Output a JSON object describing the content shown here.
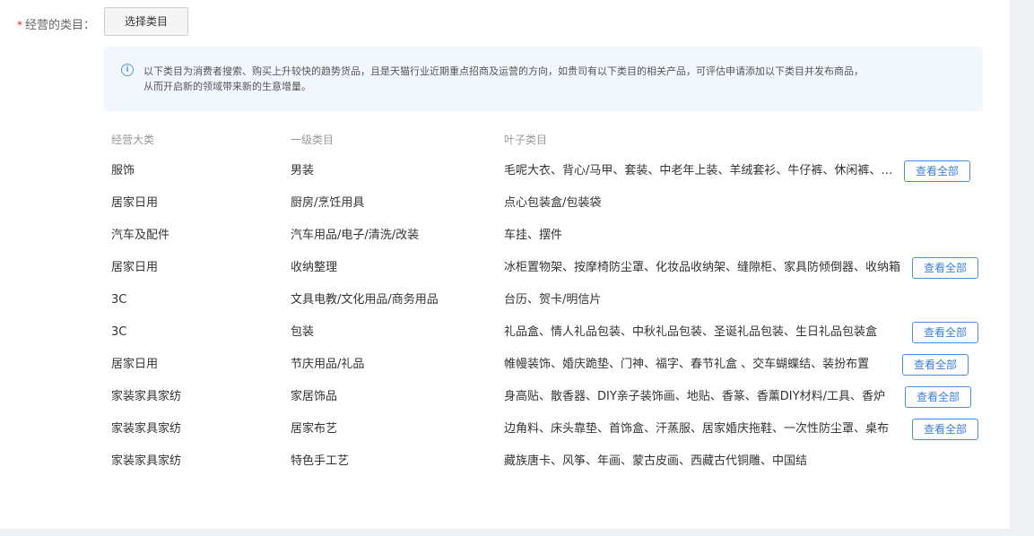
{
  "form": {
    "required_mark": "*",
    "label": "经营的类目：",
    "select_button": "选择类目"
  },
  "notice": {
    "icon": "info-icon",
    "line1": "以下类目为消费者搜索、购买上升较快的趋势货品，且是天猫行业近期重点招商及运营的方向，如贵司有以下类目的相关产品，可评估申请添加以下类目并发布商品，",
    "line2": "从而开启新的领域带来新的生意增量。"
  },
  "table": {
    "headers": [
      "经营大类",
      "一级类目",
      "叶子类目"
    ],
    "view_all_label": "查看全部",
    "rows": [
      {
        "major": "服饰",
        "level1": "男装",
        "leaf": "毛呢大衣、背心/马甲、套装、中老年上装、羊绒套衫、牛仔裤、休闲裤、衬衫",
        "has_button": true
      },
      {
        "major": "居家日用",
        "level1": "厨房/烹饪用具",
        "leaf": "点心包装盒/包装袋",
        "has_button": false
      },
      {
        "major": "汽车及配件",
        "level1": "汽车用品/电子/清洗/改装",
        "leaf": "车挂、摆件",
        "has_button": false
      },
      {
        "major": "居家日用",
        "level1": "收纳整理",
        "leaf": "冰柜置物架、按摩椅防尘罩、化妆品收纳架、缝隙柜、家具防倾倒器、收纳箱",
        "has_button": true
      },
      {
        "major": "3C",
        "level1": "文具电教/文化用品/商务用品",
        "leaf": "台历、贺卡/明信片",
        "has_button": false
      },
      {
        "major": "3C",
        "level1": "包装",
        "leaf": "礼品盒、情人礼品包装、中秋礼品包装、圣诞礼品包装、生日礼品包装盒",
        "has_button": true
      },
      {
        "major": "居家日用",
        "level1": "节庆用品/礼品",
        "leaf": "帷幔装饰、婚庆跪垫、门神、福字、春节礼盒 、交车蝴蝶结、装扮布置",
        "has_button": true
      },
      {
        "major": "家装家具家纺",
        "level1": "家居饰品",
        "leaf": "身高贴、散香器、DIY亲子装饰画、地贴、香篆、香薰DIY材料/工具、香炉",
        "has_button": true
      },
      {
        "major": "家装家具家纺",
        "level1": "居家布艺",
        "leaf": "边角料、床头靠垫、首饰盒、汗蒸服、居家婚庆拖鞋、一次性防尘罩、桌布",
        "has_button": true
      },
      {
        "major": "家装家具家纺",
        "level1": "特色手工艺",
        "leaf": "藏族唐卡、风筝、年画、蒙古皮画、西藏古代铜雕、中国结",
        "has_button": false
      }
    ]
  }
}
